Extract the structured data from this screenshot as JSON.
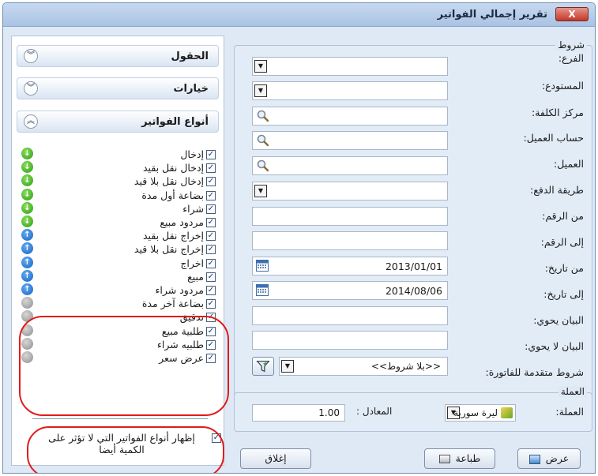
{
  "window": {
    "title": "تقرير إجمالي الفواتير",
    "close_label": "X"
  },
  "conditions": {
    "legend": "شروط",
    "rows": [
      {
        "label": "الفرع:",
        "value": ""
      },
      {
        "label": "المستودع:",
        "value": ""
      },
      {
        "label": "مركز الكلفة:",
        "value": ""
      },
      {
        "label": "حساب العميل:",
        "value": ""
      },
      {
        "label": "العميل:",
        "value": ""
      },
      {
        "label": "طريقة الدفع:",
        "value": ""
      },
      {
        "label": "من الرقم:",
        "value": ""
      },
      {
        "label": "إلى الرقم:",
        "value": ""
      },
      {
        "label": "من تاريخ:",
        "value": "2013/01/01"
      },
      {
        "label": "إلى تاريخ:",
        "value": "2014/08/06"
      },
      {
        "label": "البيان يحوي:",
        "value": ""
      },
      {
        "label": "البيان لا يحوي:",
        "value": ""
      },
      {
        "label": "شروط متقدمة للفاتورة:",
        "value": "<<بلا شروط>>"
      }
    ]
  },
  "currency": {
    "legend": "العملة",
    "label": "العملة:",
    "value": "ليرة سورية",
    "rate_label": "المعادل :",
    "rate_value": "1.00"
  },
  "buttons": {
    "view": "عرض",
    "print": "طباعة",
    "close": "إغلاق"
  },
  "left": {
    "fields_header": "الحقول",
    "options_header": "خيارات",
    "types_header": "أنواع الفواتير",
    "invoice_types": [
      {
        "label": "إدخال",
        "color": "green"
      },
      {
        "label": "إدخال نقل بقيد",
        "color": "green"
      },
      {
        "label": "إدخال نقل بلا قيد",
        "color": "green"
      },
      {
        "label": "بضاعة أول مدة",
        "color": "green"
      },
      {
        "label": "شراء",
        "color": "green"
      },
      {
        "label": "مردود مبيع",
        "color": "green"
      },
      {
        "label": "إخراج نقل بقيد",
        "color": "blue"
      },
      {
        "label": "إخراج نقل بلا قيد",
        "color": "blue"
      },
      {
        "label": "اخراج",
        "color": "blue"
      },
      {
        "label": "مبيع",
        "color": "blue"
      },
      {
        "label": "مردود شراء",
        "color": "blue"
      },
      {
        "label": "بضاعة آخر مدة",
        "color": "gray"
      },
      {
        "label": "تدقيق",
        "color": "gray"
      },
      {
        "label": "طلبية مبيع",
        "color": "gray"
      },
      {
        "label": "طلبيه شراء",
        "color": "gray"
      },
      {
        "label": "عرض سعر",
        "color": "gray"
      }
    ],
    "show_nonqty_label": "إظهار أنواع الفواتير التي لا تؤثر على الكمية أيضا"
  },
  "colors": {
    "accent_red": "#e21b1b",
    "panel_bg": "#dfe9f5"
  }
}
